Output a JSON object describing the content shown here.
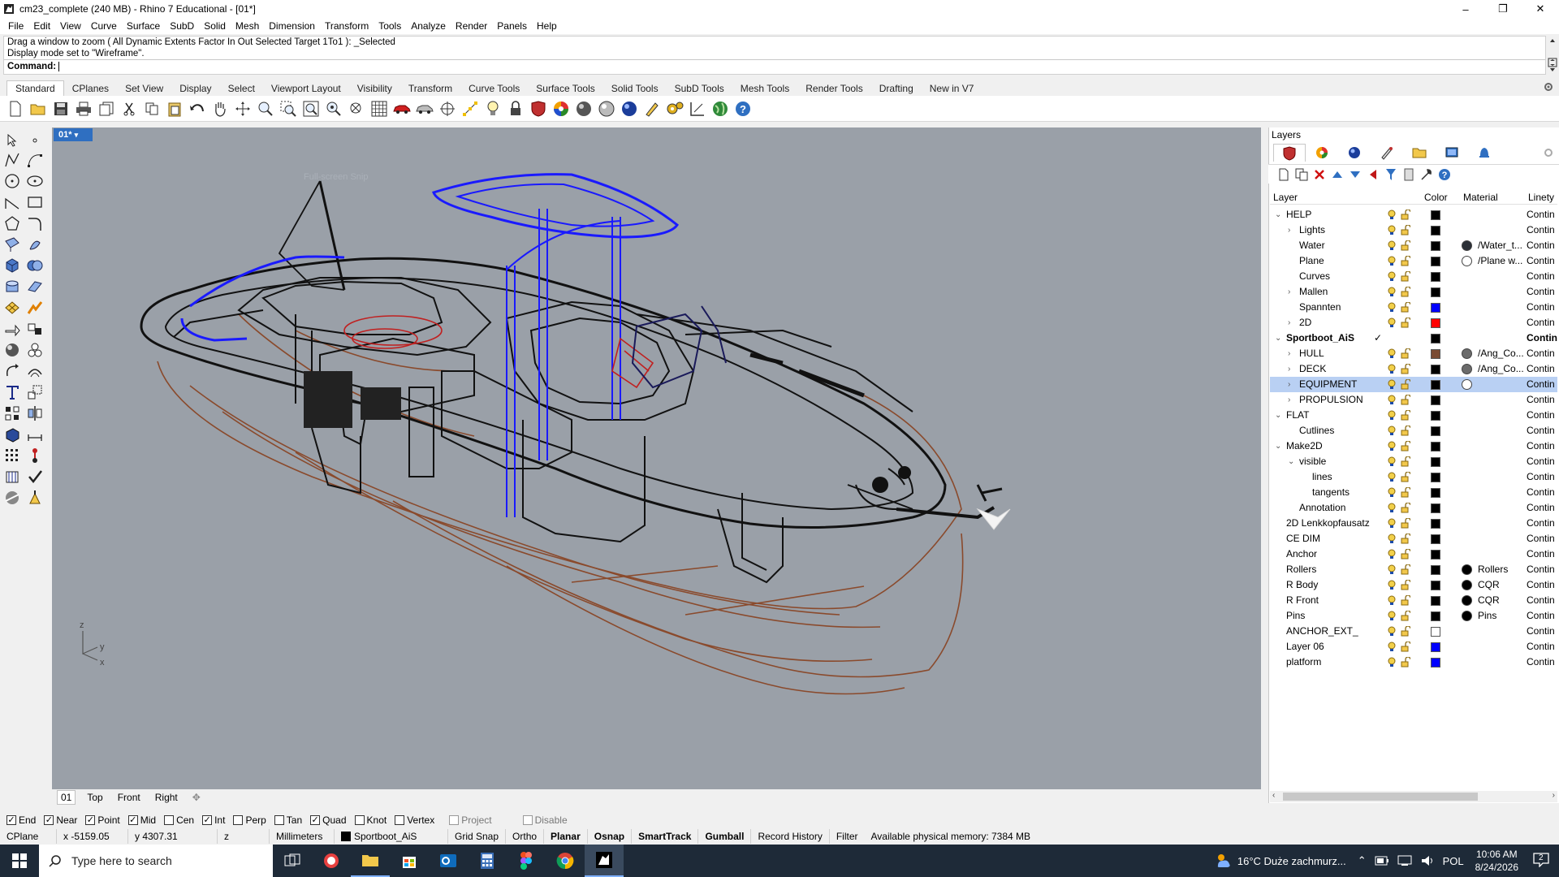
{
  "window": {
    "title": "cm23_complete (240 MB) - Rhino 7 Educational - [01*]",
    "minimize_glyph": "–",
    "maximize_glyph": "❐",
    "close_glyph": "✕"
  },
  "menu": [
    "File",
    "Edit",
    "View",
    "Curve",
    "Surface",
    "SubD",
    "Solid",
    "Mesh",
    "Dimension",
    "Transform",
    "Tools",
    "Analyze",
    "Render",
    "Panels",
    "Help"
  ],
  "command": {
    "history": [
      "Drag a window to zoom ( All  Dynamic  Extents  Factor  In  Out  Selected  Target  1To1 ): _Selected",
      "Display mode set to \"Wireframe\"."
    ],
    "prompt": "Command:",
    "value": ""
  },
  "toolbar_tabs": [
    "Standard",
    "CPlanes",
    "Set View",
    "Display",
    "Select",
    "Viewport Layout",
    "Visibility",
    "Transform",
    "Curve Tools",
    "Surface Tools",
    "Solid Tools",
    "SubD Tools",
    "Mesh Tools",
    "Render Tools",
    "Drafting",
    "New in V7"
  ],
  "toolbar_active_tab": "Standard",
  "toolbar_icons": [
    "new-file",
    "open-file",
    "save",
    "print",
    "import",
    "cut",
    "copy",
    "paste",
    "undo",
    "pan",
    "rotate-view",
    "zoom",
    "zoom-window",
    "zoom-extents",
    "zoom-selected",
    "zoom-all",
    "viewport-grid",
    "car-render",
    "render-view",
    "target",
    "select-points",
    "light",
    "lock",
    "shaded-sphere-red",
    "color-wheel",
    "sphere-gray",
    "sphere-white",
    "sphere-blue",
    "pen",
    "settings",
    "dimension",
    "web",
    "help"
  ],
  "viewport": {
    "name": "01*",
    "tabs": [
      "01",
      "Top",
      "Front",
      "Right"
    ],
    "active_tab": "01",
    "add_tab_glyph": "✥",
    "axes": {
      "z": "z",
      "y": "y",
      "x": "x"
    },
    "faded_overlay": "Full-screen Snip",
    "background": "#9aa0a8"
  },
  "layers_panel": {
    "title": "Layers",
    "columns": {
      "layer": "Layer",
      "color": "Color",
      "material": "Material",
      "linetype": "Linety"
    },
    "rows": [
      {
        "name": "HELP",
        "level": 0,
        "expander": "down",
        "color": "#000000",
        "linetype": "Contin"
      },
      {
        "name": "Lights",
        "level": 1,
        "expander": "right",
        "color": "#000000",
        "linetype": "Contin"
      },
      {
        "name": "Water",
        "level": 1,
        "expander": "",
        "color": "#000000",
        "material": "/Water_t...",
        "material_color": "#2b2f36",
        "linetype": "Contin"
      },
      {
        "name": "Plane",
        "level": 1,
        "expander": "",
        "color": "#000000",
        "material": "/Plane w...",
        "material_color": "#ffffff",
        "linetype": "Contin"
      },
      {
        "name": "Curves",
        "level": 1,
        "expander": "",
        "color": "#000000",
        "linetype": "Contin"
      },
      {
        "name": "Mallen",
        "level": 1,
        "expander": "right",
        "color": "#000000",
        "linetype": "Contin"
      },
      {
        "name": "Spannten",
        "level": 1,
        "expander": "",
        "color": "#0000ff",
        "linetype": "Contin"
      },
      {
        "name": "2D",
        "level": 1,
        "expander": "right",
        "color": "#ff0000",
        "linetype": "Contin"
      },
      {
        "name": "Sportboot_AiS",
        "level": 0,
        "expander": "down",
        "color": "#000000",
        "linetype": "Contin",
        "current": true,
        "check": "✓"
      },
      {
        "name": "HULL",
        "level": 1,
        "expander": "right",
        "color": "#7a4b33",
        "material": "/Ang_Co...",
        "material_color": "#6b6b6b",
        "linetype": "Contin"
      },
      {
        "name": "DECK",
        "level": 1,
        "expander": "right",
        "color": "#000000",
        "material": "/Ang_Co...",
        "material_color": "#6b6b6b",
        "linetype": "Contin"
      },
      {
        "name": "EQUIPMENT",
        "level": 1,
        "expander": "right",
        "color": "#000000",
        "material": "",
        "material_color": "#ffffff",
        "linetype": "Contin",
        "selected": true
      },
      {
        "name": "PROPULSION",
        "level": 1,
        "expander": "right",
        "color": "#000000",
        "linetype": "Contin"
      },
      {
        "name": "FLAT",
        "level": 0,
        "expander": "down",
        "color": "#000000",
        "linetype": "Contin"
      },
      {
        "name": "Cutlines",
        "level": 1,
        "expander": "",
        "color": "#000000",
        "linetype": "Contin"
      },
      {
        "name": "Make2D",
        "level": 0,
        "expander": "down",
        "color": "#000000",
        "linetype": "Contin"
      },
      {
        "name": "visible",
        "level": 1,
        "expander": "down",
        "color": "#000000",
        "linetype": "Contin"
      },
      {
        "name": "lines",
        "level": 2,
        "expander": "",
        "color": "#000000",
        "linetype": "Contin"
      },
      {
        "name": "tangents",
        "level": 2,
        "expander": "",
        "color": "#000000",
        "linetype": "Contin"
      },
      {
        "name": "Annotation",
        "level": 1,
        "expander": "",
        "color": "#000000",
        "linetype": "Contin"
      },
      {
        "name": "2D Lenkkopfausatz",
        "level": 0,
        "expander": "",
        "color": "#000000",
        "linetype": "Contin"
      },
      {
        "name": "CE DIM",
        "level": 0,
        "expander": "",
        "color": "#000000",
        "linetype": "Contin"
      },
      {
        "name": "Anchor",
        "level": 0,
        "expander": "",
        "color": "#000000",
        "linetype": "Contin"
      },
      {
        "name": "Rollers",
        "level": 0,
        "expander": "",
        "color": "#000000",
        "material": "Rollers",
        "material_color": "#000000",
        "linetype": "Contin"
      },
      {
        "name": "R Body",
        "level": 0,
        "expander": "",
        "color": "#000000",
        "material": "CQR",
        "material_color": "#000000",
        "linetype": "Contin"
      },
      {
        "name": "R Front",
        "level": 0,
        "expander": "",
        "color": "#000000",
        "material": "CQR",
        "material_color": "#000000",
        "linetype": "Contin"
      },
      {
        "name": "Pins",
        "level": 0,
        "expander": "",
        "color": "#000000",
        "material": "Pins",
        "material_color": "#000000",
        "linetype": "Contin"
      },
      {
        "name": "ANCHOR_EXT_",
        "level": 0,
        "expander": "",
        "color": "#ffffff",
        "linetype": "Contin"
      },
      {
        "name": "Layer 06",
        "level": 0,
        "expander": "",
        "color": "#0000ff",
        "linetype": "Contin"
      },
      {
        "name": "platform",
        "level": 0,
        "expander": "",
        "color": "#0000ff",
        "linetype": "Contin"
      }
    ]
  },
  "osnaps": [
    {
      "label": "End",
      "checked": true
    },
    {
      "label": "Near",
      "checked": true
    },
    {
      "label": "Point",
      "checked": true
    },
    {
      "label": "Mid",
      "checked": true
    },
    {
      "label": "Cen",
      "checked": false
    },
    {
      "label": "Int",
      "checked": true
    },
    {
      "label": "Perp",
      "checked": false
    },
    {
      "label": "Tan",
      "checked": false
    },
    {
      "label": "Quad",
      "checked": true
    },
    {
      "label": "Knot",
      "checked": false
    },
    {
      "label": "Vertex",
      "checked": false
    },
    {
      "label": "Project",
      "checked": false,
      "disabled": true
    },
    {
      "label": "Disable",
      "checked": false,
      "disabled": true
    }
  ],
  "status": {
    "cplane": "CPlane",
    "x": "x -5159.05",
    "y": "y 4307.31",
    "z": "z",
    "units": "Millimeters",
    "layer": "Sportboot_AiS",
    "grid_snap": "Grid Snap",
    "ortho": "Ortho",
    "planar": "Planar",
    "osnap": "Osnap",
    "smarttrack": "SmartTrack",
    "gumball": "Gumball",
    "record_history": "Record History",
    "filter": "Filter",
    "memory": "Available physical memory: 7384 MB"
  },
  "taskbar": {
    "search_placeholder": "Type here to search",
    "weather": "16°C  Duże zachmurz...",
    "language": "POL",
    "time": "10:06 AM",
    "date": "8/24/2026",
    "notification_count": "2"
  },
  "colors": {
    "accent": "#2f6fc1",
    "hull_brown": "#8a4a2c",
    "wire_blue": "#1a1aff",
    "wire_red": "#c02020",
    "selected_row": "#b9d0f3",
    "taskbar": "#1e2a38"
  }
}
